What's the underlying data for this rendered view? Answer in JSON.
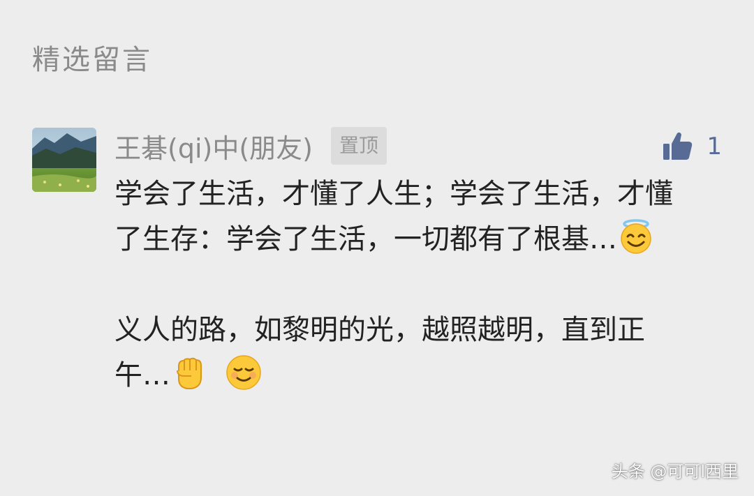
{
  "section": {
    "title": "精选留言"
  },
  "comment": {
    "author": "王碁(qi)中(朋友)",
    "pin_label": "置顶",
    "like_count": "1",
    "paragraph1_text": "学会了生活，才懂了人生；学会了生活，才懂了生存：学会了生活，一切都有了根基…",
    "paragraph2_text": "义人的路，如黎明的光，越照越明，直到正午…",
    "emojis": [
      "smiling-face-with-halo",
      "raised-fist",
      "smiling-face"
    ]
  },
  "watermark": {
    "text": "头条 @可可l西里"
  },
  "colors": {
    "background": "#ededed",
    "name_gray": "#8a8a8a",
    "link_blue": "#576b95",
    "text_dark": "#222222"
  }
}
